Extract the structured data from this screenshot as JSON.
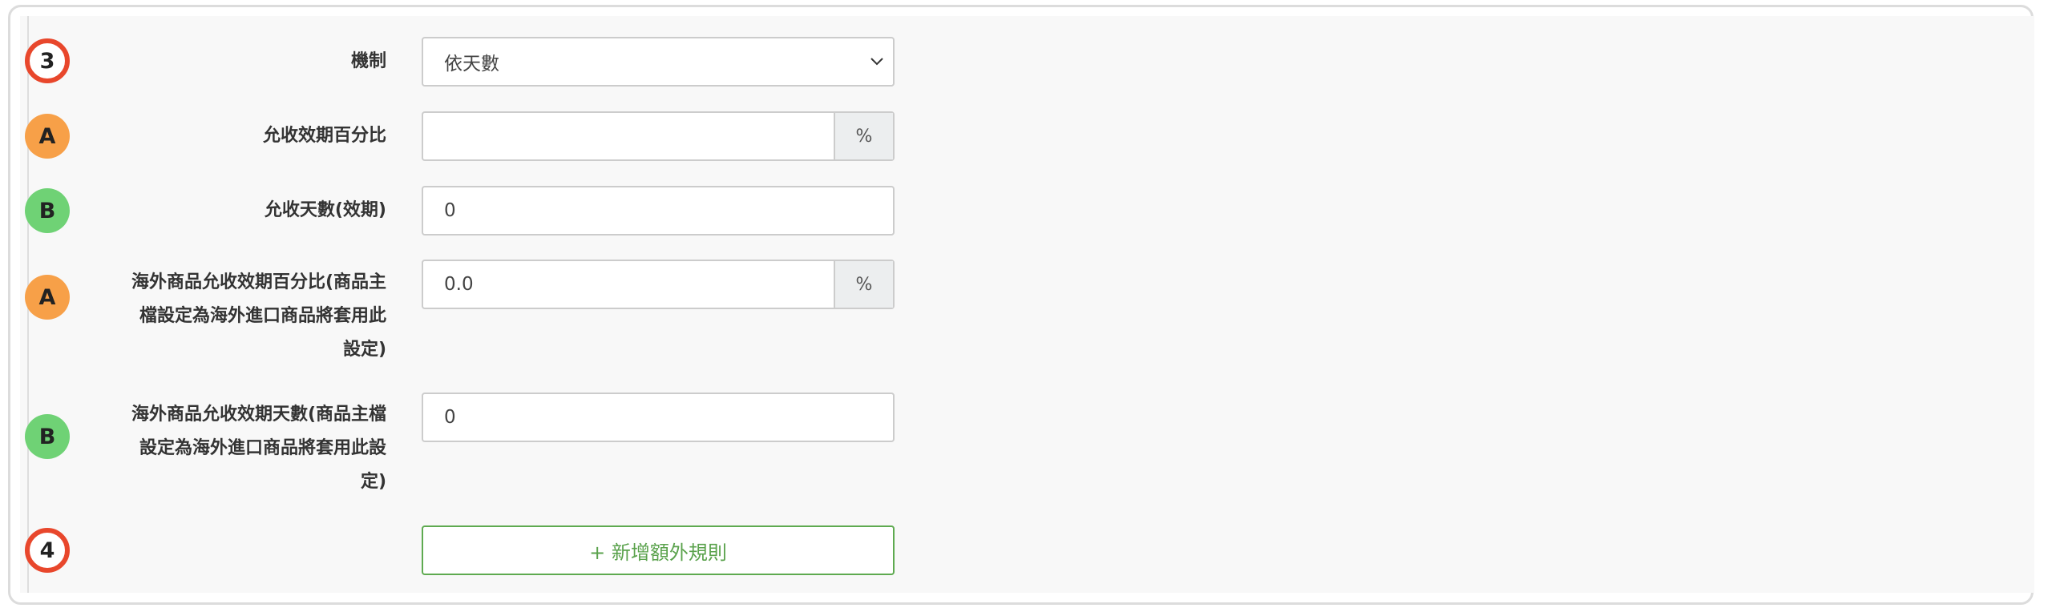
{
  "rows": [
    {
      "badge": "3",
      "label": "機制",
      "value": "依天數"
    },
    {
      "badge": "A",
      "label": "允收效期百分比",
      "value": "",
      "addon": "%"
    },
    {
      "badge": "B",
      "label": "允收天數(效期)",
      "value": "0"
    },
    {
      "badge": "A",
      "label_lines": [
        "海外商品允收效期百分比(商品主",
        "檔設定為海外進口商品將套用此",
        "設定)"
      ],
      "value": "0.0",
      "addon": "%"
    },
    {
      "badge": "B",
      "label_lines": [
        "海外商品允收效期天數(商品主檔",
        "設定為海外進口商品將套用此設",
        "定)"
      ],
      "value": "0"
    }
  ],
  "add_rule": {
    "badge": "4",
    "label": "+ 新增額外規則"
  },
  "colors": {
    "step_ring": "#e8472c",
    "badge_a": "#f7a048",
    "badge_b": "#6fd275",
    "add_button": "#5aa24c"
  },
  "icons": {
    "select_arrow": "chevron-down-icon"
  }
}
